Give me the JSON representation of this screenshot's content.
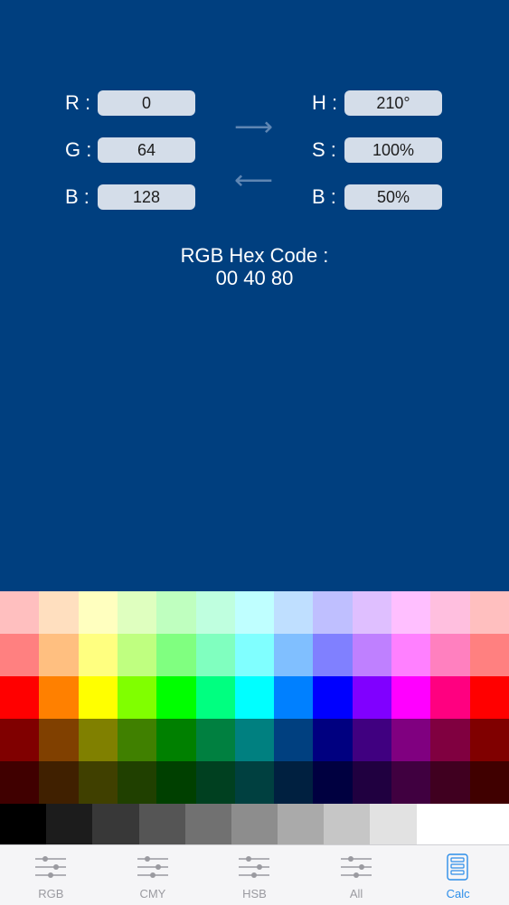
{
  "converter": {
    "rgb": [
      {
        "label": "R :",
        "value": "0"
      },
      {
        "label": "G :",
        "value": "64"
      },
      {
        "label": "B :",
        "value": "128"
      }
    ],
    "hsb": [
      {
        "label": "H :",
        "value": "210°"
      },
      {
        "label": "S :",
        "value": "100%"
      },
      {
        "label": "B :",
        "value": "50%"
      }
    ],
    "arrow_right": "⟶",
    "arrow_left": "⟵",
    "hex_title": "RGB Hex Code :",
    "hex_value": "00 40 80"
  },
  "colors": {
    "background": "#003f7f",
    "field_bg": "#d4dde9",
    "tab_active": "#2d8ee9",
    "tab_inactive": "#9a9aa0"
  },
  "palette": {
    "rows": [
      [
        "#ffbfbf",
        "#ffdfbf",
        "#ffffbf",
        "#dfffbf",
        "#bfffbf",
        "#bfffdf",
        "#bfffff",
        "#bfdfff",
        "#bfbfff",
        "#dfbfff",
        "#ffbfff",
        "#ffbfdf",
        "#ffbfbf"
      ],
      [
        "#ff8080",
        "#ffbf80",
        "#ffff80",
        "#bfff80",
        "#80ff80",
        "#80ffbf",
        "#80ffff",
        "#80bfff",
        "#8080ff",
        "#bf80ff",
        "#ff80ff",
        "#ff80bf",
        "#ff8080"
      ],
      [
        "#ff0000",
        "#ff8000",
        "#ffff00",
        "#80ff00",
        "#00ff00",
        "#00ff80",
        "#00ffff",
        "#0080ff",
        "#0000ff",
        "#8000ff",
        "#ff00ff",
        "#ff0080",
        "#ff0000"
      ],
      [
        "#800000",
        "#804000",
        "#808000",
        "#408000",
        "#008000",
        "#008040",
        "#008080",
        "#004080",
        "#000080",
        "#400080",
        "#800080",
        "#800040",
        "#800000"
      ],
      [
        "#400000",
        "#402000",
        "#404000",
        "#204000",
        "#004000",
        "#004020",
        "#004040",
        "#002040",
        "#000040",
        "#200040",
        "#400040",
        "#400020",
        "#400000"
      ]
    ],
    "grays": [
      "#000000",
      "#1c1c1c",
      "#383838",
      "#555555",
      "#717171",
      "#8d8d8d",
      "#aaaaaa",
      "#c6c6c6",
      "#e2e2e2",
      "#ffffff",
      "#ffffff"
    ]
  },
  "tabs": [
    {
      "label": "RGB",
      "icon": "sliders-icon",
      "active": false
    },
    {
      "label": "CMY",
      "icon": "sliders-icon",
      "active": false
    },
    {
      "label": "HSB",
      "icon": "sliders-icon",
      "active": false
    },
    {
      "label": "All",
      "icon": "sliders-icon",
      "active": false
    },
    {
      "label": "Calc",
      "icon": "calculator-icon",
      "active": true
    }
  ]
}
